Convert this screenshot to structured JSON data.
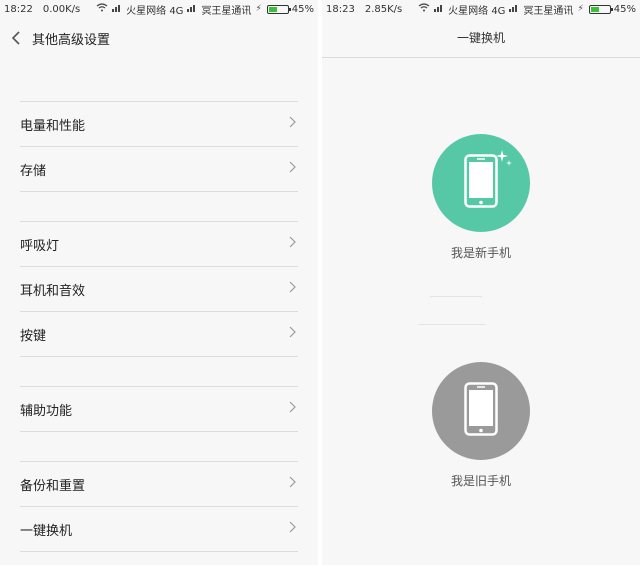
{
  "left": {
    "status": {
      "time": "18:22",
      "speed": "0.00K/s",
      "carrier1": "火星网络 4G",
      "carrier2": "冥王星通讯",
      "battery": "45%",
      "battery_level": 0.45
    },
    "title": "其他高级设置",
    "items": [
      {
        "label": "电量和性能"
      },
      {
        "label": "存储"
      },
      {
        "label": "呼吸灯"
      },
      {
        "label": "耳机和音效"
      },
      {
        "label": "按键"
      },
      {
        "label": "辅助功能"
      },
      {
        "label": "备份和重置"
      },
      {
        "label": "一键换机"
      }
    ]
  },
  "right": {
    "status": {
      "time": "18:23",
      "speed": "2.85K/s",
      "carrier1": "火星网络 4G",
      "carrier2": "冥王星通讯",
      "battery": "45%",
      "battery_level": 0.45
    },
    "title": "一键换机",
    "new_phone_label": "我是新手机",
    "old_phone_label": "我是旧手机"
  },
  "colors": {
    "new_phone_circle": "#56c8a6",
    "old_phone_circle": "#9a9a9a",
    "battery_fill": "#3cc03c"
  },
  "icons": {
    "back": "back-arrow-icon",
    "chevron": "chevron-right-icon",
    "phone": "smartphone-icon",
    "sparkle": "sparkle-icon"
  }
}
